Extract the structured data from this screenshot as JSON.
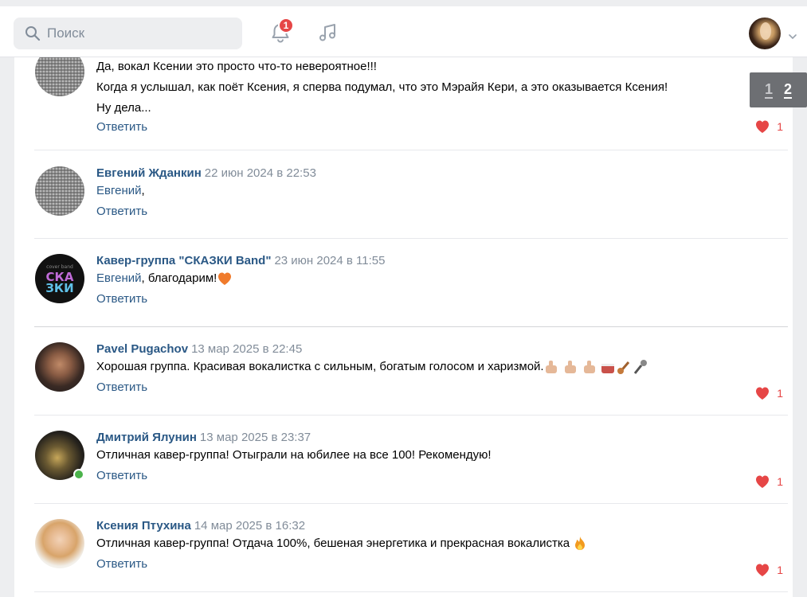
{
  "header": {
    "search_placeholder": "Поиск",
    "notification_count": "1"
  },
  "pager": {
    "page1": "1",
    "page2": "2"
  },
  "colors": {
    "link": "#2a5885",
    "like": "#e64646",
    "online": "#4bb34b"
  },
  "comments": [
    {
      "author": "",
      "date": "",
      "lines": [
        "Да, вокал Ксении это просто что-то невероятное!!!",
        "Когда я услышал, как поёт Ксения, я сперва подумал, что это Мэрайя Кери, а это оказывается Ксения!",
        "Ну дела..."
      ],
      "reply": "Ответить",
      "likes": "1"
    },
    {
      "author": "Евгений Жданкин",
      "date": "22 июн 2024 в 22:53",
      "mention": "Евгений",
      "text": ",",
      "reply": "Ответить"
    },
    {
      "author": "Кавер-группа \"СКАЗКИ Band\"",
      "date": "23 июн 2024 в 11:55",
      "mention": "Евгений",
      "text": ", благодарим!",
      "reply": "Ответить"
    },
    {
      "author": "Pavel Pugachov",
      "date": "13 мар 2025 в 22:45",
      "text": "Хорошая группа. Красивая вокалистка с сильным, богатым голосом и харизмой.",
      "reply": "Ответить",
      "likes": "1"
    },
    {
      "author": "Дмитрий Ялунин",
      "date": "13 мар 2025 в 23:37",
      "text": "Отличная кавер-группа! Отыграли на юбилее на все 100! Рекомендую!",
      "reply": "Ответить",
      "likes": "1"
    },
    {
      "author": "Ксения Птухина",
      "date": "14 мар 2025 в 16:32",
      "text": "Отличная кавер-группа! Отдача 100%, бешеная энергетика и прекрасная вокалистка",
      "reply": "Ответить",
      "likes": "1"
    }
  ]
}
